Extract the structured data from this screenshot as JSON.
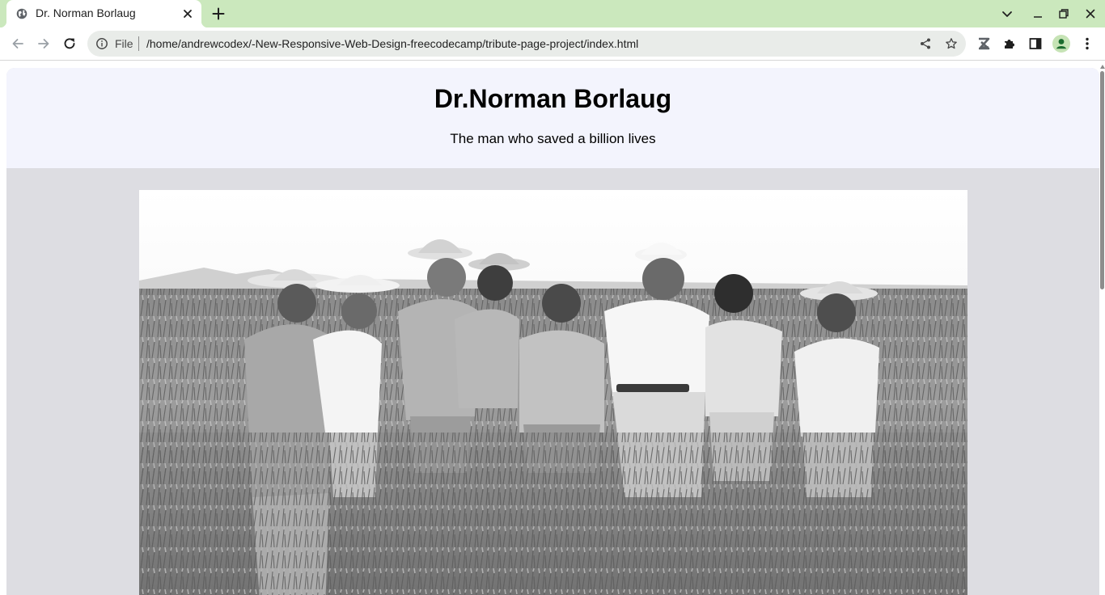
{
  "browser": {
    "tab": {
      "title": "Dr. Norman Borlaug",
      "favicon": "globe-icon"
    },
    "address_bar": {
      "scheme_label": "File",
      "url": "/home/andrewcodex/-New-Responsive-Web-Design-freecodecamp/tribute-page-project/index.html"
    },
    "icons": {
      "back": "back-arrow-icon",
      "forward": "forward-arrow-icon",
      "reload": "reload-icon",
      "info": "info-icon",
      "share": "share-icon",
      "bookmark": "star-icon",
      "extension_z": "z-extension-icon",
      "extensions": "puzzle-icon",
      "side_panel": "side-panel-icon",
      "profile": "profile-avatar-icon",
      "menu": "kebab-menu-icon",
      "tab_search": "chevron-down-icon",
      "minimize": "minimize-icon",
      "restore": "restore-icon",
      "close": "close-icon"
    },
    "colors": {
      "tabstrip": "#cbe8bd",
      "omnibox": "#e9ece9",
      "profile_bg": "#c6e3b5",
      "profile_fg": "#1b6c2e"
    }
  },
  "page": {
    "title": "Dr.Norman Borlaug",
    "subtitle": "The man who saved a billion lives",
    "image": {
      "subject": "black-and-white photograph of men in hats standing in a wheat field"
    },
    "colors": {
      "header_bg": "#f3f4fd",
      "main_bg": "#dddde2"
    }
  }
}
